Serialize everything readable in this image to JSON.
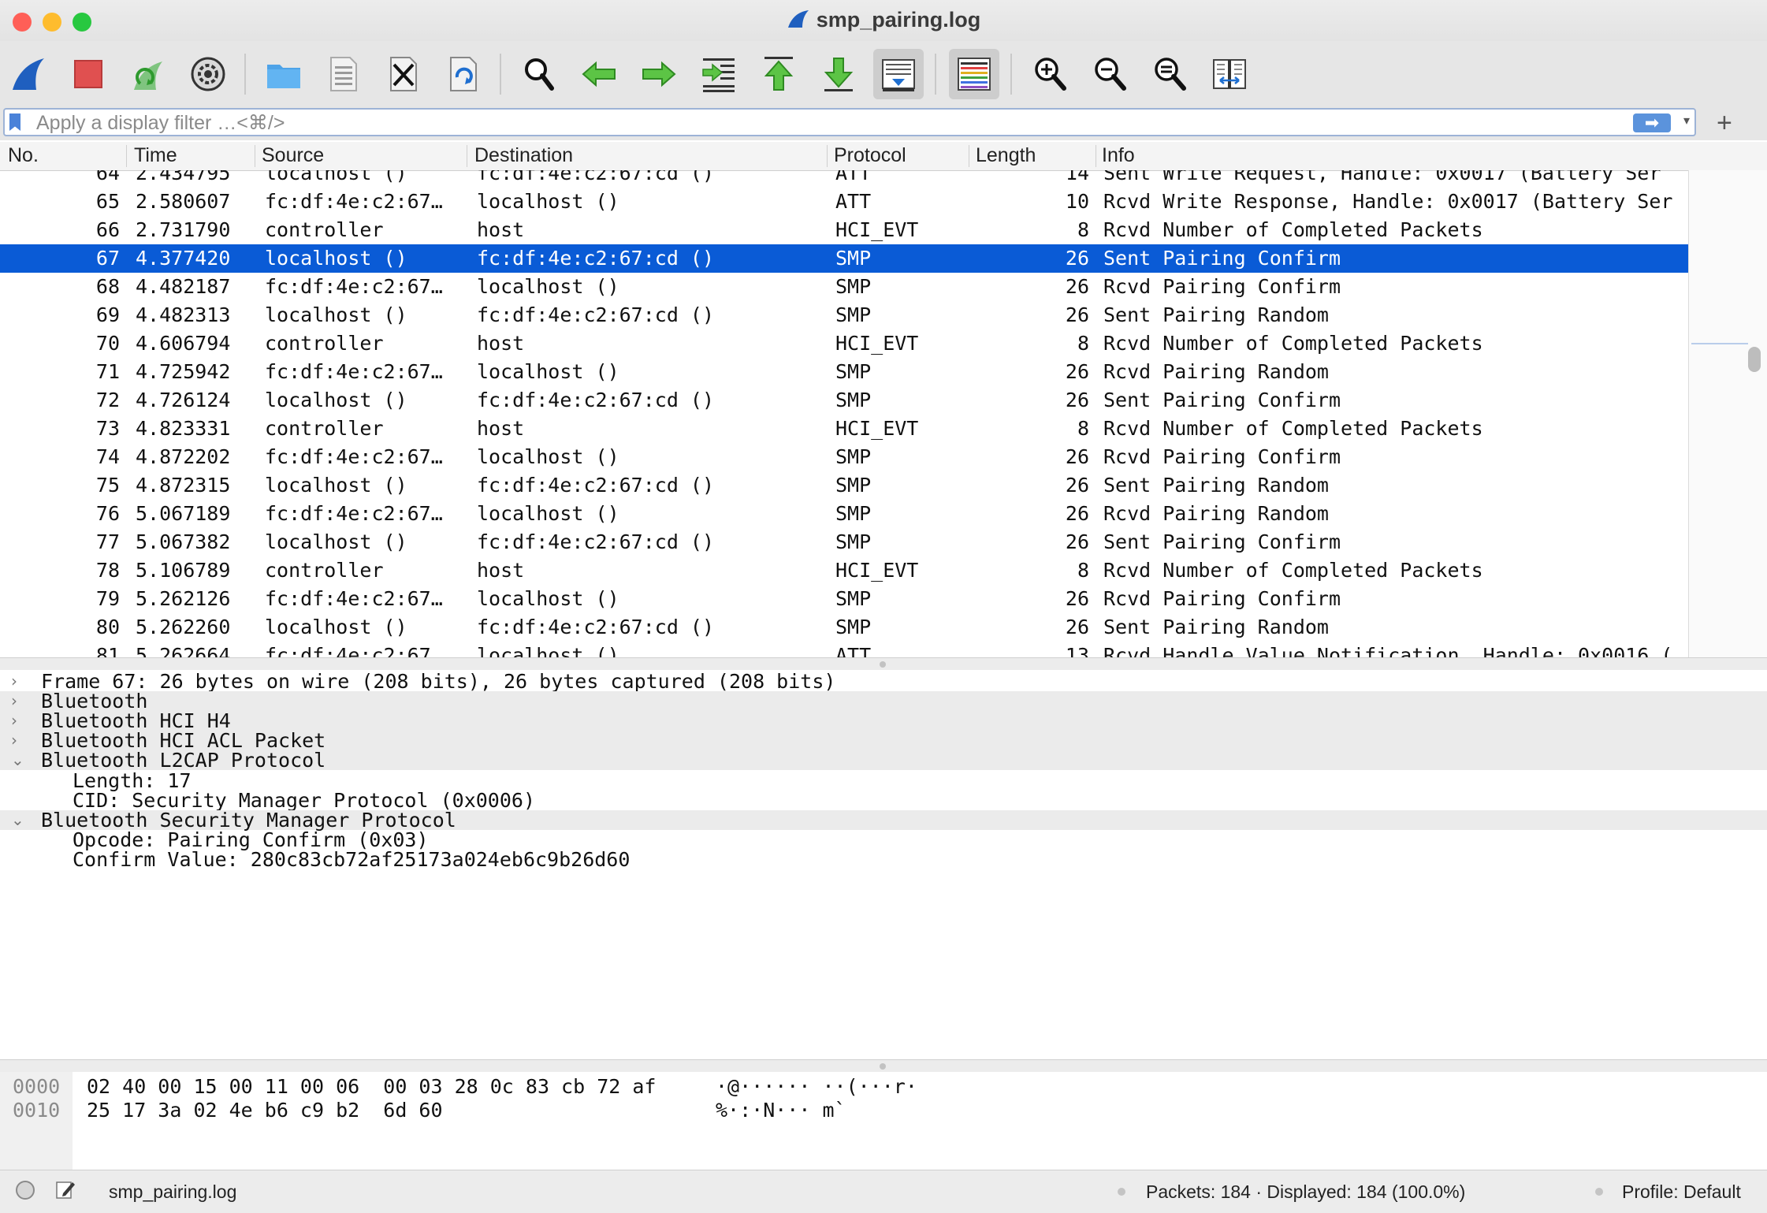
{
  "window": {
    "title": "smp_pairing.log",
    "traffic_colors": {
      "close": "#ff5f57",
      "minimize": "#febc2e",
      "zoom": "#28c840"
    }
  },
  "toolbar": {
    "buttons": [
      {
        "name": "start-capture-button",
        "icon": "shark-fin-icon"
      },
      {
        "name": "stop-capture-button",
        "icon": "stop-square-icon"
      },
      {
        "name": "restart-capture-button",
        "icon": "restart-fin-icon"
      },
      {
        "name": "capture-options-button",
        "icon": "gear-icon"
      },
      {
        "name": "open-file-button",
        "icon": "folder-icon"
      },
      {
        "name": "save-file-button",
        "icon": "binary-file-icon"
      },
      {
        "name": "close-file-button",
        "icon": "close-file-icon"
      },
      {
        "name": "reload-file-button",
        "icon": "reload-file-icon"
      },
      {
        "name": "find-packet-button",
        "icon": "magnifier-icon"
      },
      {
        "name": "go-back-button",
        "icon": "arrow-left-icon"
      },
      {
        "name": "go-forward-button",
        "icon": "arrow-right-icon"
      },
      {
        "name": "go-to-packet-button",
        "icon": "jump-to-packet-icon"
      },
      {
        "name": "go-first-packet-button",
        "icon": "arrow-up-to-top-icon"
      },
      {
        "name": "go-last-packet-button",
        "icon": "arrow-down-to-bottom-icon"
      },
      {
        "name": "autoscroll-button",
        "icon": "autoscroll-icon"
      },
      {
        "name": "colorize-button",
        "icon": "colorize-lines-icon"
      },
      {
        "name": "zoom-in-button",
        "icon": "zoom-in-icon"
      },
      {
        "name": "zoom-out-button",
        "icon": "zoom-out-icon"
      },
      {
        "name": "normal-size-button",
        "icon": "zoom-reset-icon"
      },
      {
        "name": "resize-columns-button",
        "icon": "resize-columns-icon"
      }
    ]
  },
  "filter": {
    "placeholder": "Apply a display filter …<⌘/>",
    "value": "",
    "apply_arrow": "➡",
    "dropdown": "▾",
    "add_button": "+"
  },
  "packet_list": {
    "columns": [
      "No.",
      "Time",
      "Source",
      "Destination",
      "Protocol",
      "Length",
      "Info"
    ],
    "rows": [
      {
        "no": "64",
        "time": "2.434795",
        "src": "localhost ()",
        "dst": "fc:df:4e:c2:67:cd ()",
        "proto": "ATT",
        "len": "14",
        "info": "Sent Write Request, Handle: 0x0017 (Battery Ser",
        "selected": false
      },
      {
        "no": "65",
        "time": "2.580607",
        "src": "fc:df:4e:c2:67…",
        "dst": "localhost ()",
        "proto": "ATT",
        "len": "10",
        "info": "Rcvd Write Response, Handle: 0x0017 (Battery Ser",
        "selected": false
      },
      {
        "no": "66",
        "time": "2.731790",
        "src": "controller",
        "dst": "host",
        "proto": "HCI_EVT",
        "len": "8",
        "info": "Rcvd Number of Completed Packets",
        "selected": false
      },
      {
        "no": "67",
        "time": "4.377420",
        "src": "localhost ()",
        "dst": "fc:df:4e:c2:67:cd ()",
        "proto": "SMP",
        "len": "26",
        "info": "Sent Pairing Confirm",
        "selected": true
      },
      {
        "no": "68",
        "time": "4.482187",
        "src": "fc:df:4e:c2:67…",
        "dst": "localhost ()",
        "proto": "SMP",
        "len": "26",
        "info": "Rcvd Pairing Confirm",
        "selected": false
      },
      {
        "no": "69",
        "time": "4.482313",
        "src": "localhost ()",
        "dst": "fc:df:4e:c2:67:cd ()",
        "proto": "SMP",
        "len": "26",
        "info": "Sent Pairing Random",
        "selected": false
      },
      {
        "no": "70",
        "time": "4.606794",
        "src": "controller",
        "dst": "host",
        "proto": "HCI_EVT",
        "len": "8",
        "info": "Rcvd Number of Completed Packets",
        "selected": false
      },
      {
        "no": "71",
        "time": "4.725942",
        "src": "fc:df:4e:c2:67…",
        "dst": "localhost ()",
        "proto": "SMP",
        "len": "26",
        "info": "Rcvd Pairing Random",
        "selected": false
      },
      {
        "no": "72",
        "time": "4.726124",
        "src": "localhost ()",
        "dst": "fc:df:4e:c2:67:cd ()",
        "proto": "SMP",
        "len": "26",
        "info": "Sent Pairing Confirm",
        "selected": false
      },
      {
        "no": "73",
        "time": "4.823331",
        "src": "controller",
        "dst": "host",
        "proto": "HCI_EVT",
        "len": "8",
        "info": "Rcvd Number of Completed Packets",
        "selected": false
      },
      {
        "no": "74",
        "time": "4.872202",
        "src": "fc:df:4e:c2:67…",
        "dst": "localhost ()",
        "proto": "SMP",
        "len": "26",
        "info": "Rcvd Pairing Confirm",
        "selected": false
      },
      {
        "no": "75",
        "time": "4.872315",
        "src": "localhost ()",
        "dst": "fc:df:4e:c2:67:cd ()",
        "proto": "SMP",
        "len": "26",
        "info": "Sent Pairing Random",
        "selected": false
      },
      {
        "no": "76",
        "time": "5.067189",
        "src": "fc:df:4e:c2:67…",
        "dst": "localhost ()",
        "proto": "SMP",
        "len": "26",
        "info": "Rcvd Pairing Random",
        "selected": false
      },
      {
        "no": "77",
        "time": "5.067382",
        "src": "localhost ()",
        "dst": "fc:df:4e:c2:67:cd ()",
        "proto": "SMP",
        "len": "26",
        "info": "Sent Pairing Confirm",
        "selected": false
      },
      {
        "no": "78",
        "time": "5.106789",
        "src": "controller",
        "dst": "host",
        "proto": "HCI_EVT",
        "len": "8",
        "info": "Rcvd Number of Completed Packets",
        "selected": false
      },
      {
        "no": "79",
        "time": "5.262126",
        "src": "fc:df:4e:c2:67…",
        "dst": "localhost ()",
        "proto": "SMP",
        "len": "26",
        "info": "Rcvd Pairing Confirm",
        "selected": false
      },
      {
        "no": "80",
        "time": "5.262260",
        "src": "localhost ()",
        "dst": "fc:df:4e:c2:67:cd ()",
        "proto": "SMP",
        "len": "26",
        "info": "Sent Pairing Random",
        "selected": false
      },
      {
        "no": "81",
        "time": "5.262664",
        "src": "fc:df:4e:c2:67…",
        "dst": "localhost ()",
        "proto": "ATT",
        "len": "13",
        "info": "Rcvd Handle Value Notification, Handle: 0x0016 (",
        "selected": false
      }
    ],
    "selected_color": "#0a5bd6"
  },
  "details": {
    "rows": [
      {
        "text": "Frame 67: 26 bytes on wire (208 bits), 26 bytes captured (208 bits)",
        "arrow": "›",
        "level": 0,
        "highlight": false
      },
      {
        "text": "Bluetooth",
        "arrow": "›",
        "level": 0,
        "highlight": true
      },
      {
        "text": "Bluetooth HCI H4",
        "arrow": "›",
        "level": 0,
        "highlight": true
      },
      {
        "text": "Bluetooth HCI ACL Packet",
        "arrow": "›",
        "level": 0,
        "highlight": true
      },
      {
        "text": "Bluetooth L2CAP Protocol",
        "arrow": "⌄",
        "level": 0,
        "highlight": true
      },
      {
        "text": "Length: 17",
        "arrow": "",
        "level": 1,
        "highlight": false
      },
      {
        "text": "CID: Security Manager Protocol (0x0006)",
        "arrow": "",
        "level": 1,
        "highlight": false
      },
      {
        "text": "Bluetooth Security Manager Protocol",
        "arrow": "⌄",
        "level": 0,
        "highlight": true
      },
      {
        "text": "Opcode: Pairing Confirm (0x03)",
        "arrow": "",
        "level": 1,
        "highlight": false
      },
      {
        "text": "Confirm Value: 280c83cb72af25173a024eb6c9b26d60",
        "arrow": "",
        "level": 1,
        "highlight": false
      }
    ]
  },
  "bytes": {
    "rows": [
      {
        "offset": "0000",
        "hex": "02 40 00 15 00 11 00 06  00 03 28 0c 83 cb 72 af",
        "ascii": "·@······ ··(···r·"
      },
      {
        "offset": "0010",
        "hex": "25 17 3a 02 4e b6 c9 b2  6d 60",
        "ascii": "%·:·N··· m`"
      }
    ]
  },
  "status": {
    "file": "smp_pairing.log",
    "packets": "Packets: 184 · Displayed: 184 (100.0%)",
    "profile": "Profile: Default"
  }
}
